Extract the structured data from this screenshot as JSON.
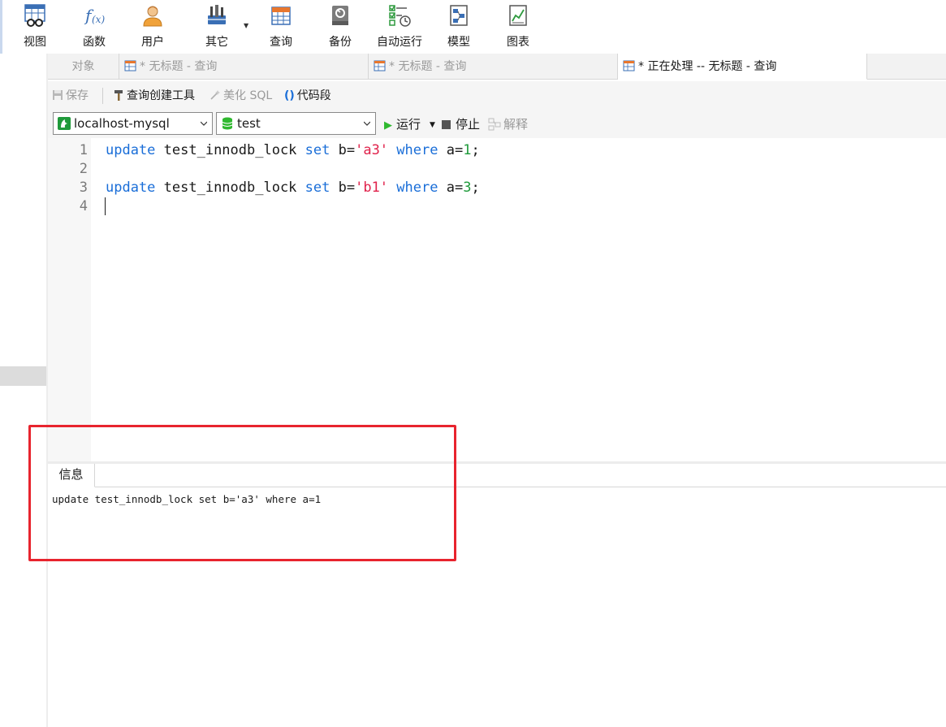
{
  "toolbar": {
    "items": [
      {
        "label": "视图",
        "icon": "view-table-glasses-icon"
      },
      {
        "label": "函数",
        "icon": "function-fx-icon"
      },
      {
        "label": "用户",
        "icon": "user-icon"
      },
      {
        "label": "其它",
        "icon": "tools-icon"
      },
      {
        "label": "查询",
        "icon": "query-table-icon"
      },
      {
        "label": "备份",
        "icon": "backup-icon"
      },
      {
        "label": "自动运行",
        "icon": "automation-checklist-icon"
      },
      {
        "label": "模型",
        "icon": "model-icon"
      },
      {
        "label": "图表",
        "icon": "chart-icon"
      }
    ]
  },
  "tabs": {
    "objects": "对象",
    "items": [
      {
        "label": "* 无标题 - 查询",
        "active": false
      },
      {
        "label": "* 无标题 - 查询",
        "active": false
      },
      {
        "label": "* 正在处理 -- 无标题 - 查询",
        "active": true
      }
    ]
  },
  "subtoolbar": {
    "save": "保存",
    "query_builder": "查询创建工具",
    "beautify": "美化 SQL",
    "snippet": "代码段"
  },
  "connection": {
    "server": "localhost-mysql",
    "database": "test",
    "run": "运行",
    "stop": "停止",
    "explain": "解释"
  },
  "editor": {
    "line_numbers": [
      "1",
      "2",
      "3",
      "4"
    ],
    "lines": [
      [
        {
          "t": "update",
          "c": "kw"
        },
        {
          "t": " test_innodb_lock ",
          "c": ""
        },
        {
          "t": "set",
          "c": "kw"
        },
        {
          "t": " b=",
          "c": ""
        },
        {
          "t": "'a3'",
          "c": "str"
        },
        {
          "t": " ",
          "c": ""
        },
        {
          "t": "where",
          "c": "kw"
        },
        {
          "t": " a=",
          "c": ""
        },
        {
          "t": "1",
          "c": "num"
        },
        {
          "t": ";",
          "c": ""
        }
      ],
      [],
      [
        {
          "t": "update",
          "c": "kw"
        },
        {
          "t": " test_innodb_lock ",
          "c": ""
        },
        {
          "t": "set",
          "c": "kw"
        },
        {
          "t": " b=",
          "c": ""
        },
        {
          "t": "'b1'",
          "c": "str"
        },
        {
          "t": " ",
          "c": ""
        },
        {
          "t": "where",
          "c": "kw"
        },
        {
          "t": " a=",
          "c": ""
        },
        {
          "t": "3",
          "c": "num"
        },
        {
          "t": ";",
          "c": ""
        }
      ],
      []
    ]
  },
  "info_panel": {
    "tab_label": "信息",
    "message": "update test_innodb_lock set b='a3' where a=1"
  },
  "colors": {
    "keyword": "#1a6ed8",
    "string": "#e0224b",
    "number": "#1e9a3a",
    "annotation": "#e8242e",
    "run_green": "#2fb82f"
  }
}
